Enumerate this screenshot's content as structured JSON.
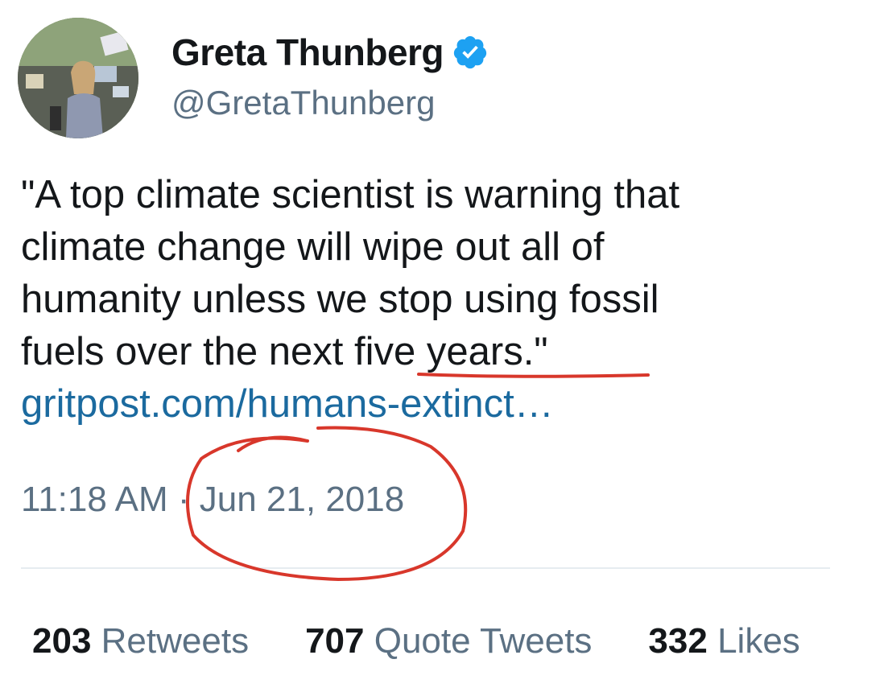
{
  "user": {
    "display_name": "Greta Thunberg",
    "handle": "@GretaThunberg",
    "verified": true
  },
  "tweet": {
    "text_lines": [
      "\"A top climate scientist is warning that",
      "climate change will wipe out all of",
      "humanity unless we stop using fossil",
      "fuels over the next five years.\""
    ],
    "link": "gritpost.com/humans-extinct…",
    "time": "11:18 AM",
    "separator": "·",
    "date": "Jun 21, 2018"
  },
  "stats": {
    "retweets": {
      "count": "203",
      "label": "Retweets"
    },
    "quote_tweets": {
      "count": "707",
      "label": "Quote Tweets"
    },
    "likes": {
      "count": "332",
      "label": "Likes"
    }
  },
  "colors": {
    "text": "#14171a",
    "secondary": "#5b7083",
    "link": "#1b6a9f",
    "verified": "#1da1f2",
    "annotation": "#d8372b"
  },
  "icons": {
    "verified": "verified-badge-icon",
    "avatar": "profile-photo"
  }
}
